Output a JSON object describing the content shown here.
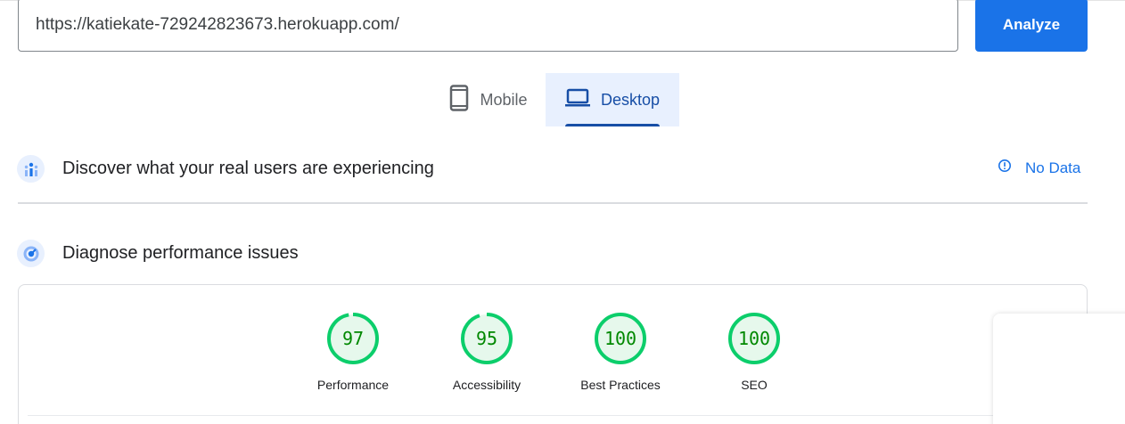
{
  "search": {
    "url": "https://katiekate-729242823673.herokuapp.com/"
  },
  "toolbar": {
    "analyze_label": "Analyze"
  },
  "tabs": [
    {
      "label": "Mobile",
      "icon": "smartphone-icon",
      "selected": false
    },
    {
      "label": "Desktop",
      "icon": "laptop-icon",
      "selected": true
    }
  ],
  "field_data": {
    "title": "Discover what your real users are experiencing",
    "status_label": "No Data"
  },
  "lab_data": {
    "title": "Diagnose performance issues",
    "scores": [
      {
        "label": "Performance",
        "value": "97",
        "score": 0.97
      },
      {
        "label": "Accessibility",
        "value": "95",
        "score": 0.95
      },
      {
        "label": "Best Practices",
        "value": "100",
        "score": 1.0
      },
      {
        "label": "SEO",
        "value": "100",
        "score": 1.0
      }
    ]
  },
  "colors": {
    "accent": "#1a73e8",
    "pass": "#0cce6b",
    "pass_text": "#008800",
    "pass_fill": "#e6f8ec"
  }
}
